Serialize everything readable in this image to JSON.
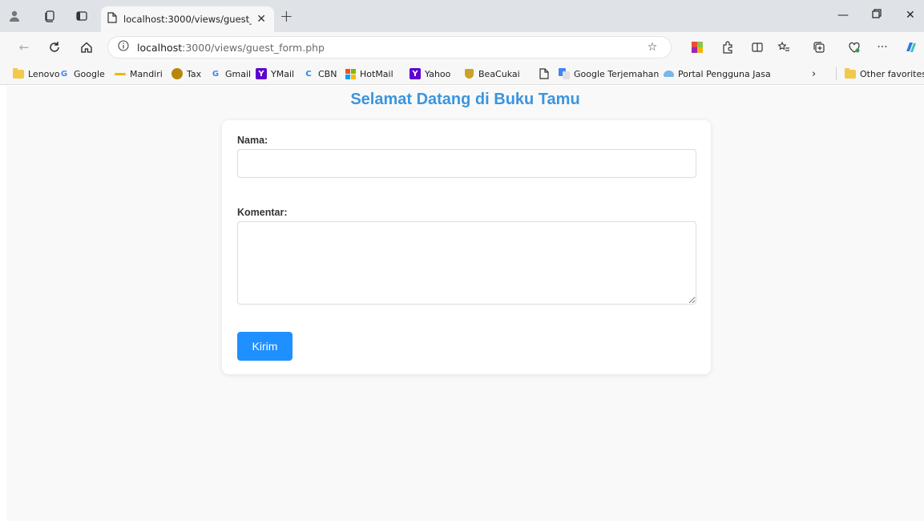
{
  "browser": {
    "tab": {
      "title": "localhost:3000/views/guest_form.php"
    },
    "address_bar": {
      "host": "localhost",
      "path": ":3000/views/guest_form.php"
    },
    "bookmarks": [
      {
        "label": "Lenovo",
        "icon": "folder-icon"
      },
      {
        "label": "Google",
        "icon": "google-icon"
      },
      {
        "label": "Mandiri",
        "icon": "mandiri-icon"
      },
      {
        "label": "Tax",
        "icon": "tax-icon"
      },
      {
        "label": "Gmail",
        "icon": "google-icon"
      },
      {
        "label": "YMail",
        "icon": "yahoo-icon"
      },
      {
        "label": "CBN",
        "icon": "cbn-icon"
      },
      {
        "label": "HotMail",
        "icon": "microsoft-icon"
      },
      {
        "label": "Yahoo",
        "icon": "yahoo-icon"
      },
      {
        "label": "BeaCukai",
        "icon": "beacukai-icon"
      },
      {
        "label": "",
        "icon": "page-icon"
      },
      {
        "label": "Google Terjemahan",
        "icon": "translate-icon"
      },
      {
        "label": "Portal Pengguna Jasa",
        "icon": "portal-icon"
      }
    ],
    "other_favorites": "Other favorites",
    "colors": {
      "chrome": "#dfe3e8",
      "toolbar": "#f7f7f7"
    }
  },
  "page": {
    "title": "Selamat Datang di Buku Tamu",
    "form": {
      "name_label": "Nama:",
      "name_value": "",
      "comment_label": "Komentar:",
      "comment_value": "",
      "submit_label": "Kirim"
    },
    "colors": {
      "title": "#3a95e0",
      "button": "#1e90ff",
      "background": "#f9f9f9"
    }
  }
}
